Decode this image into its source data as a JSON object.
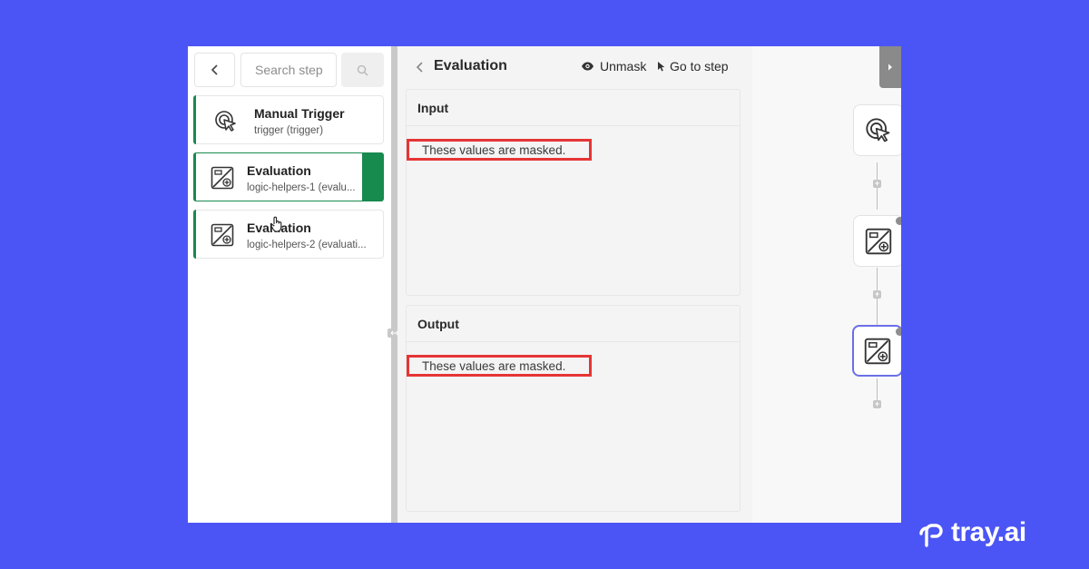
{
  "steps_panel": {
    "search": {
      "placeholder": "Search step"
    },
    "items": [
      {
        "title": "Manual Trigger",
        "subtitle": "trigger (trigger)",
        "icon": "cursor-click-icon"
      },
      {
        "title": "Evaluation",
        "subtitle": "logic-helpers-1 (evalu...",
        "icon": "evaluation-icon",
        "selected": true
      },
      {
        "title": "Evaluation",
        "subtitle": "logic-helpers-2 (evaluati...",
        "icon": "evaluation-icon"
      }
    ]
  },
  "inspector": {
    "title": "Evaluation",
    "unmask_label": "Unmask",
    "goto_label": "Go to step",
    "input": {
      "heading": "Input",
      "masked_text": "These values are masked."
    },
    "output": {
      "heading": "Output",
      "masked_text": "These values are masked."
    }
  },
  "brand": {
    "name": "tray.ai"
  },
  "colors": {
    "background": "#4b55f5",
    "accent_green": "#178a4e",
    "mask_outline": "#e53535",
    "active_node": "#6b6fe8"
  }
}
